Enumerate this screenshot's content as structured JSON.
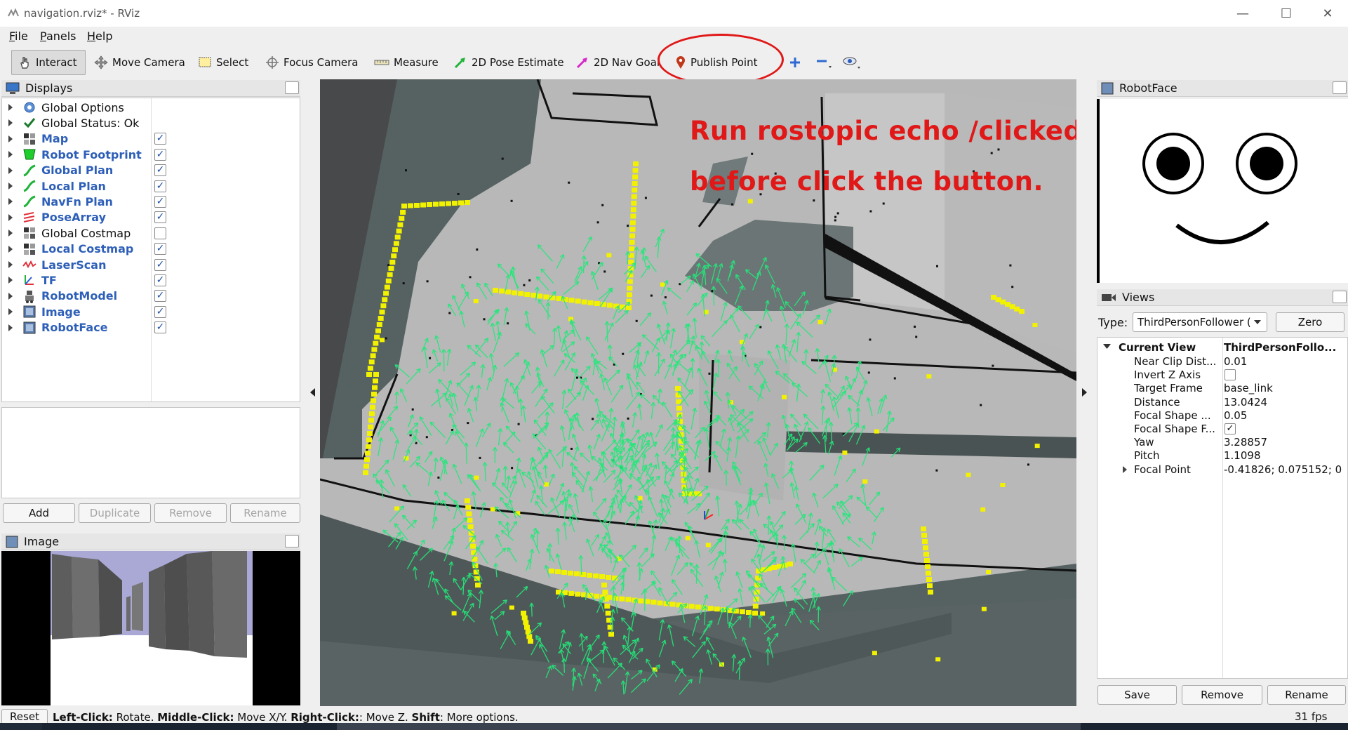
{
  "window": {
    "title": "navigation.rviz* - RViz",
    "minimize_glyph": "—",
    "maximize_glyph": "☐",
    "close_glyph": "✕"
  },
  "menu": [
    {
      "label": "File",
      "accel": "F"
    },
    {
      "label": "Panels",
      "accel": "P"
    },
    {
      "label": "Help",
      "accel": "H"
    }
  ],
  "toolbar": {
    "tools": [
      {
        "label": "Interact",
        "icon": "hand-pointer-icon",
        "active": true
      },
      {
        "label": "Move Camera",
        "icon": "move-camera-icon"
      },
      {
        "label": "Select",
        "icon": "select-box-icon"
      },
      {
        "label": "Focus Camera",
        "icon": "focus-crosshair-icon"
      },
      {
        "label": "Measure",
        "icon": "ruler-icon"
      },
      {
        "label": "2D Pose Estimate",
        "icon": "green-arrow-icon"
      },
      {
        "label": "2D Nav Goal",
        "icon": "magenta-arrow-icon"
      },
      {
        "label": "Publish Point",
        "icon": "map-pin-icon",
        "highlighted": true
      }
    ],
    "extra_icons": [
      "plus-icon",
      "minus-icon",
      "eye-icon"
    ]
  },
  "displays_panel": {
    "title": "Displays",
    "items": [
      {
        "label": "Global Options",
        "icon": "gear-icon",
        "bold": false
      },
      {
        "label": "Global Status: Ok",
        "icon": "check-icon",
        "bold": false
      },
      {
        "label": "Map",
        "icon": "map-grid-icon",
        "bold": true,
        "checked": true
      },
      {
        "label": "Robot Footprint",
        "icon": "footprint-icon",
        "bold": true,
        "checked": true
      },
      {
        "label": "Global Plan",
        "icon": "path-icon",
        "bold": true,
        "checked": true
      },
      {
        "label": "Local Plan",
        "icon": "path-icon",
        "bold": true,
        "checked": true
      },
      {
        "label": "NavFn Plan",
        "icon": "path-icon",
        "bold": true,
        "checked": true
      },
      {
        "label": "PoseArray",
        "icon": "pose-array-icon",
        "bold": true,
        "checked": true
      },
      {
        "label": "Global Costmap",
        "icon": "map-grid-icon",
        "bold": false,
        "checked": false
      },
      {
        "label": "Local Costmap",
        "icon": "map-grid-icon",
        "bold": true,
        "checked": true
      },
      {
        "label": "LaserScan",
        "icon": "laser-scan-icon",
        "bold": true,
        "checked": true
      },
      {
        "label": "TF",
        "icon": "tf-axes-icon",
        "bold": true,
        "checked": true
      },
      {
        "label": "RobotModel",
        "icon": "robot-model-icon",
        "bold": true,
        "checked": true
      },
      {
        "label": "Image",
        "icon": "image-icon",
        "bold": true,
        "checked": true
      },
      {
        "label": "RobotFace",
        "icon": "image-icon",
        "bold": true,
        "checked": true
      }
    ],
    "buttons": {
      "add": "Add",
      "duplicate": "Duplicate",
      "remove": "Remove",
      "rename": "Rename"
    }
  },
  "image_panel": {
    "title": "Image"
  },
  "viewport": {
    "annotation_line1": "Run rostopic echo /clicked_point",
    "annotation_line2": "before click the button.",
    "colors": {
      "annotation": "#e01818",
      "floor": "#b9b9b9",
      "wall": "#576262",
      "pose_arrows": "#22e87a",
      "costmap": "#f2f200"
    }
  },
  "robotface_panel": {
    "title": "RobotFace"
  },
  "views_panel": {
    "title": "Views",
    "type_label": "Type:",
    "type_value": "ThirdPersonFollower (",
    "zero_button": "Zero",
    "current_view": {
      "name": "Current View",
      "value": "ThirdPersonFollo..."
    },
    "props": [
      {
        "name": "Near Clip Dist...",
        "value": "0.01"
      },
      {
        "name": "Invert Z Axis",
        "checkbox": true,
        "checked": false
      },
      {
        "name": "Target Frame",
        "value": "base_link"
      },
      {
        "name": "Distance",
        "value": "13.0424"
      },
      {
        "name": "Focal Shape ...",
        "value": "0.05"
      },
      {
        "name": "Focal Shape F...",
        "checkbox": true,
        "checked": true
      },
      {
        "name": "Yaw",
        "value": "3.28857"
      },
      {
        "name": "Pitch",
        "value": "1.1098"
      },
      {
        "name": "Focal Point",
        "value": "-0.41826; 0.075152; 0",
        "expandable": true
      }
    ],
    "buttons": {
      "save": "Save",
      "remove": "Remove",
      "rename": "Rename"
    }
  },
  "statusbar": {
    "reset": "Reset",
    "hint_left_key": "Left-Click:",
    "hint_left_val": " Rotate. ",
    "hint_mid_key": "Middle-Click:",
    "hint_mid_val": " Move X/Y. ",
    "hint_right_key": "Right-Click:",
    "hint_right_val": ": Move Z. ",
    "hint_shift_key": "Shift",
    "hint_shift_val": ": More options.",
    "fps": "31 fps"
  }
}
